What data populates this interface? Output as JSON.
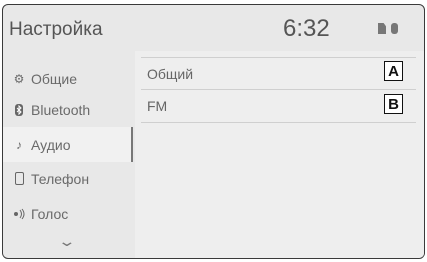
{
  "header": {
    "title": "Настройка",
    "clock": "6:32",
    "status_icons": [
      "sim-icon",
      "bluetooth-status-icon"
    ]
  },
  "sidebar": {
    "items": [
      {
        "label": "Общие",
        "icon": "gear-icon",
        "active": false
      },
      {
        "label": "Bluetooth",
        "icon": "bluetooth-icon",
        "active": false
      },
      {
        "label": "Аудио",
        "icon": "music-note-icon",
        "active": true
      },
      {
        "label": "Телефон",
        "icon": "phone-icon",
        "active": false
      },
      {
        "label": "Голос",
        "icon": "voice-icon",
        "active": false
      }
    ],
    "more_icon": "chevron-down-icon"
  },
  "main": {
    "rows": [
      {
        "label": "Общий"
      },
      {
        "label": "FM"
      }
    ]
  },
  "callouts": [
    "A",
    "B"
  ],
  "colors": {
    "screen_bg": "#e8e8e8",
    "text": "#666666",
    "active_item_bg": "#f1f1f1"
  }
}
